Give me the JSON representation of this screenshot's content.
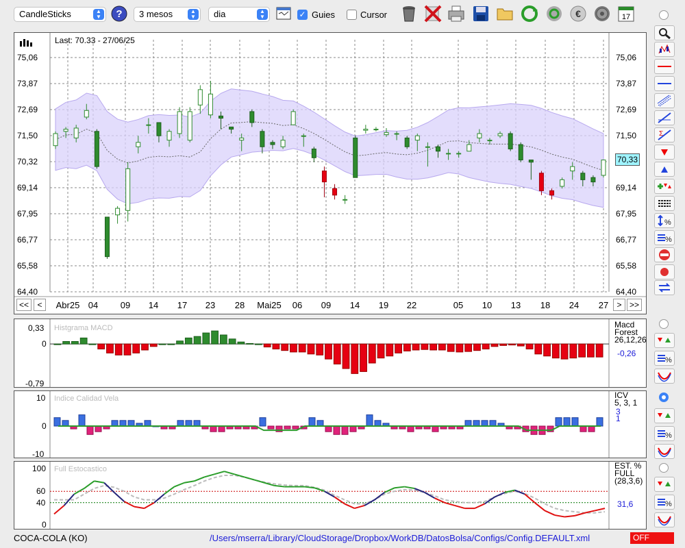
{
  "toolbar": {
    "chart_type": "CandleSticks",
    "period": "3 mesos",
    "interval": "dia",
    "guides_label": "Guies",
    "guides_checked": true,
    "cursor_label": "Cursor",
    "cursor_checked": false,
    "calendar_day": "17",
    "icons": [
      "help-icon",
      "table-icon",
      "trash-icon",
      "delete-icon",
      "printer-icon",
      "save-icon",
      "folder-icon",
      "refresh-icon",
      "update-icon",
      "currency-icon",
      "gear-icon",
      "calendar-icon"
    ]
  },
  "main_chart": {
    "last_label": "Last: 70.33 - 27/06/25",
    "current_price": "70,33",
    "y_ticks": [
      "75,06",
      "73,87",
      "72,69",
      "71,50",
      "70,32",
      "69,14",
      "67,95",
      "66,77",
      "65,58",
      "64,40"
    ],
    "x_ticks": [
      "Abr25",
      "04",
      "09",
      "14",
      "17",
      "23",
      "28",
      "Mai25",
      "06",
      "09",
      "14",
      "19",
      "22",
      "05",
      "10",
      "13",
      "18",
      "24",
      "27"
    ],
    "nav": {
      "first": "<<",
      "prev": "<",
      "next": ">",
      "last": ">>"
    }
  },
  "chart_data": [
    {
      "type": "candlestick",
      "ylim": [
        64.4,
        75.06
      ],
      "colors": {
        "up": "#ffffff",
        "down": "#2e8b2e",
        "band": "#c8bff0",
        "down_red": "#e60012"
      },
      "candles": [
        [
          71.05,
          71.6,
          71.7,
          70.9
        ],
        [
          71.7,
          71.8,
          71.9,
          71.4
        ],
        [
          71.4,
          71.85,
          72.0,
          71.2
        ],
        [
          72.35,
          72.65,
          72.95,
          72.25
        ],
        [
          71.7,
          70.1,
          71.8,
          70.0
        ],
        [
          67.8,
          66.0,
          67.8,
          65.9
        ],
        [
          67.9,
          68.2,
          68.3,
          67.5
        ],
        [
          68.1,
          70.0,
          70.3,
          67.6
        ],
        [
          71.0,
          71.2,
          71.5,
          70.7
        ],
        [
          72.0,
          72.0,
          72.3,
          71.6
        ],
        [
          72.1,
          71.5,
          72.1,
          71.2
        ],
        [
          71.3,
          71.7,
          71.8,
          71.0
        ],
        [
          71.6,
          72.6,
          72.8,
          71.4
        ],
        [
          71.3,
          72.6,
          72.8,
          71.2
        ],
        [
          72.9,
          73.6,
          73.8,
          72.5
        ],
        [
          72.45,
          73.4,
          74.0,
          72.3
        ],
        [
          72.4,
          72.3,
          72.6,
          71.8
        ],
        [
          71.9,
          71.8,
          71.9,
          71.6
        ],
        [
          71.3,
          71.4,
          71.6,
          70.8
        ],
        [
          72.6,
          72.1,
          72.7,
          71.9
        ],
        [
          71.7,
          71.0,
          71.8,
          70.7
        ],
        [
          71.2,
          71.1,
          71.3,
          70.9
        ],
        [
          71.0,
          71.3,
          71.5,
          70.9
        ],
        [
          72.0,
          72.6,
          72.7,
          72.0
        ],
        [
          71.5,
          71.5,
          71.6,
          71.0
        ],
        [
          70.9,
          70.5,
          71.0,
          70.3
        ],
        [
          69.9,
          69.4,
          70.1,
          68.7
        ],
        [
          69.1,
          68.8,
          69.3,
          68.6
        ],
        [
          68.6,
          68.6,
          68.8,
          68.4
        ],
        [
          71.4,
          69.6,
          71.5,
          69.6
        ],
        [
          71.75,
          71.8,
          72.0,
          71.6
        ],
        [
          71.8,
          71.8,
          71.9,
          71.7
        ],
        [
          71.55,
          71.65,
          71.85,
          71.45
        ],
        [
          71.6,
          71.6,
          71.7,
          71.3
        ],
        [
          71.4,
          71.0,
          71.5,
          70.9
        ],
        [
          71.3,
          71.5,
          71.6,
          70.8
        ],
        [
          71.0,
          71.0,
          71.2,
          70.1
        ],
        [
          71.0,
          70.8,
          71.1,
          70.5
        ],
        [
          70.7,
          70.7,
          70.9,
          70.4
        ],
        [
          70.7,
          70.7,
          70.8,
          70.5
        ],
        [
          70.8,
          71.1,
          71.3,
          70.8
        ],
        [
          71.4,
          71.6,
          71.8,
          71.2
        ],
        [
          71.3,
          71.3,
          71.4,
          71.1
        ],
        [
          71.5,
          71.6,
          71.7,
          71.4
        ],
        [
          71.6,
          70.9,
          71.7,
          70.8
        ],
        [
          71.1,
          70.4,
          71.2,
          70.3
        ],
        [
          70.4,
          70.3,
          70.4,
          69.5
        ],
        [
          69.8,
          69.0,
          69.9,
          68.8
        ],
        [
          69.0,
          68.8,
          69.1,
          68.6
        ],
        [
          69.2,
          69.5,
          69.6,
          69.1
        ],
        [
          69.9,
          70.1,
          70.3,
          69.5
        ],
        [
          69.8,
          69.5,
          69.9,
          69.2
        ],
        [
          69.6,
          69.4,
          69.7,
          69.2
        ],
        [
          69.7,
          70.4,
          70.4,
          69.6
        ]
      ]
    },
    {
      "type": "bar",
      "title": "Histgrama MACD",
      "legend": [
        "Macd",
        "Forest",
        "26,12,26"
      ],
      "last_value": "-0,26",
      "y_ticks": [
        "0,33",
        "0",
        "-0,79"
      ],
      "ylim": [
        -0.79,
        0.33
      ],
      "values": [
        0.0,
        0.05,
        0.05,
        0.12,
        0.0,
        -0.1,
        -0.18,
        -0.22,
        -0.22,
        -0.18,
        -0.12,
        -0.05,
        0.0,
        0.0,
        0.06,
        0.12,
        0.15,
        0.22,
        0.26,
        0.18,
        0.1,
        0.04,
        0.01,
        0.0,
        -0.06,
        -0.1,
        -0.13,
        -0.16,
        -0.16,
        -0.2,
        -0.22,
        -0.3,
        -0.4,
        -0.49,
        -0.59,
        -0.55,
        -0.38,
        -0.28,
        -0.24,
        -0.18,
        -0.14,
        -0.12,
        -0.11,
        -0.12,
        -0.12,
        -0.15,
        -0.16,
        -0.15,
        -0.13,
        -0.1,
        -0.05,
        -0.03,
        -0.02,
        -0.04,
        -0.1,
        -0.2,
        -0.24,
        -0.28,
        -0.3,
        -0.28,
        -0.26,
        -0.26,
        -0.26
      ]
    },
    {
      "type": "bar",
      "title": "Indice Calidad Vela",
      "legend": [
        "ICV",
        "5, 3, 1"
      ],
      "values_label": [
        "3",
        "1"
      ],
      "y_ticks": [
        "10",
        "0",
        "-10"
      ],
      "ylim": [
        -10,
        10
      ],
      "values": [
        3,
        2,
        -1,
        4,
        -3,
        -2,
        -1,
        2,
        2,
        2,
        1,
        2,
        0,
        -1,
        -1,
        2,
        2,
        2,
        -1,
        -2,
        -2,
        -1,
        -1,
        -1,
        -1,
        3,
        -1,
        -2,
        -1,
        -1,
        -1,
        3,
        2,
        -2,
        -3,
        -3,
        -2,
        -1,
        4,
        2,
        1,
        -1,
        -1,
        -2,
        -1,
        -1,
        -2,
        -1,
        -1,
        -1,
        2,
        2,
        2,
        2,
        1,
        -1,
        -1,
        -2,
        -3,
        -3,
        -2,
        3,
        3,
        3,
        -2,
        -2,
        3
      ]
    },
    {
      "type": "line",
      "title": "Full Estocastico",
      "legend": [
        "EST. %",
        "FULL",
        "(28,3,6)"
      ],
      "last_value": "31,6",
      "y_ticks": [
        "100",
        "60",
        "40",
        "0"
      ],
      "ylim": [
        0,
        100
      ],
      "series": [
        {
          "name": "K",
          "values": [
            20,
            35,
            55,
            65,
            78,
            75,
            58,
            42,
            33,
            30,
            40,
            55,
            68,
            75,
            78,
            85,
            90,
            95,
            90,
            85,
            80,
            75,
            70,
            68,
            68,
            68,
            66,
            60,
            50,
            38,
            30,
            35,
            45,
            58,
            66,
            68,
            65,
            58,
            48,
            40,
            35,
            30,
            30,
            38,
            50,
            58,
            62,
            55,
            40,
            26,
            18,
            15,
            17,
            22,
            26,
            30
          ]
        },
        {
          "name": "D",
          "values": [
            45,
            45,
            45,
            55,
            65,
            70,
            67,
            60,
            50,
            45,
            45,
            48,
            55,
            63,
            70,
            78,
            84,
            88,
            88,
            85,
            80,
            76,
            73,
            71,
            70,
            70,
            67,
            62,
            53,
            45,
            38,
            38,
            45,
            55,
            60,
            63,
            62,
            58,
            52,
            45,
            42,
            40,
            40,
            42,
            50,
            56,
            60,
            56,
            48,
            38,
            30,
            26,
            24,
            22,
            22,
            24
          ]
        }
      ]
    }
  ],
  "right_tools": [
    "zoom-icon",
    "candlestick-icon",
    "red-hline-icon",
    "blue-hline-icon",
    "channel-icon",
    "trendline-icon",
    "sigma-icon",
    "arrow-down-icon",
    "arrow-up-icon",
    "add-arrows-icon",
    "list-icon",
    "scale-percent-icon",
    "hline-percent-icon",
    "no-entry-icon",
    "record-icon",
    "swap-icon"
  ],
  "status_bar": {
    "ticker": "COCA-COLA (KO)",
    "config_path": "/Users/mserra/Library/CloudStorage/Dropbox/WorkDB/DatosBolsa/Configs/Config.DEFAULT.xml",
    "off_label": "OFF"
  }
}
